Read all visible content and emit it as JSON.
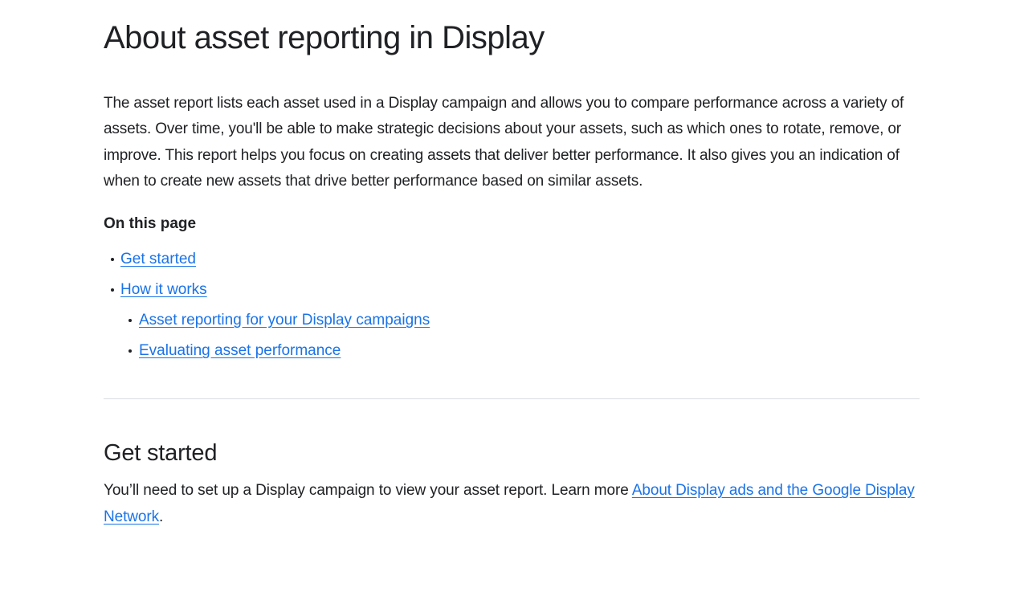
{
  "article": {
    "title": "About asset reporting in Display",
    "intro": "The asset report lists each asset used in a Display campaign and allows you to compare performance across a variety of assets. Over time, you'll be able to make strategic decisions about your assets, such as which ones to rotate, remove, or improve. This report helps you focus on creating assets that deliver better performance. It also gives you an indication of when to create new assets that drive better performance based on similar assets.",
    "toc": {
      "heading": "On this page",
      "items": [
        {
          "label": "Get started",
          "level": 1
        },
        {
          "label": "How it works",
          "level": 1
        },
        {
          "label": "Asset reporting for your Display campaigns",
          "level": 2
        },
        {
          "label": "Evaluating asset performance",
          "level": 2
        }
      ]
    },
    "section": {
      "heading": "Get started",
      "text_before_link": "You’ll need to set up a Display campaign to view your asset report. Learn more ",
      "link_text": "About Display ads and the Google Display Network",
      "text_after_link": "."
    }
  },
  "colors": {
    "text": "#202124",
    "link": "#1a73e8",
    "divider": "#dadce0",
    "background": "#ffffff"
  }
}
